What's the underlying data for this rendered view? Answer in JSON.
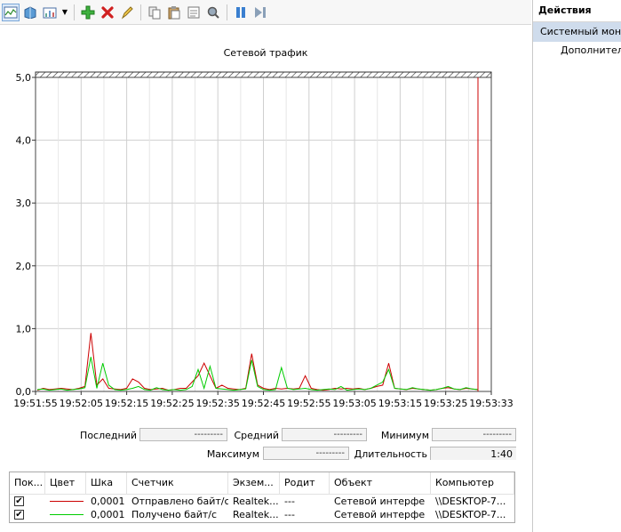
{
  "toolbar": {
    "buttons": [
      {
        "icon": "view-graph-icon",
        "active": true
      },
      {
        "icon": "view-histogram-icon"
      },
      {
        "icon": "change-graph-type-icon"
      },
      {
        "icon": "add-counter-icon"
      },
      {
        "icon": "delete-counter-icon"
      },
      {
        "icon": "highlight-icon"
      },
      {
        "icon": "copy-properties-icon"
      },
      {
        "icon": "paste-counter-list-icon"
      },
      {
        "icon": "properties-icon"
      },
      {
        "icon": "zoom-icon"
      },
      {
        "icon": "freeze-display-icon"
      },
      {
        "icon": "update-data-icon"
      }
    ]
  },
  "actions": {
    "header": "Действия",
    "section": "Системный мони",
    "item": "Дополнител"
  },
  "chart_data": {
    "type": "line",
    "title": "Сетевой трафик",
    "ylim": [
      0,
      5
    ],
    "yticks": [
      "0,0",
      "1,0",
      "2,0",
      "3,0",
      "4,0",
      "5,0"
    ],
    "xticks": [
      "19:51:55",
      "19:52:05",
      "19:52:15",
      "19:52:25",
      "19:52:35",
      "19:52:45",
      "19:52:55",
      "19:53:05",
      "19:53:15",
      "19:53:25",
      "19:53:33"
    ],
    "grid": true,
    "series": [
      {
        "name": "Отправлено байт/с",
        "color": "#cc0000",
        "values": [
          0.02,
          0.05,
          0.03,
          0.04,
          0.05,
          0.04,
          0.03,
          0.05,
          0.08,
          0.93,
          0.1,
          0.2,
          0.05,
          0.04,
          0.03,
          0.05,
          0.2,
          0.15,
          0.05,
          0.03,
          0.04,
          0.05,
          0.02,
          0.03,
          0.05,
          0.05,
          0.15,
          0.25,
          0.45,
          0.25,
          0.05,
          0.1,
          0.05,
          0.04,
          0.03,
          0.05,
          0.6,
          0.1,
          0.05,
          0.03,
          0.05,
          0.04,
          0.05,
          0.04,
          0.05,
          0.25,
          0.05,
          0.03,
          0.02,
          0.03,
          0.05,
          0.04,
          0.05,
          0.04,
          0.05,
          0.03,
          0.05,
          0.08,
          0.1,
          0.45,
          0.05,
          0.04,
          0.03,
          0.05,
          0.04,
          0.03,
          0.02,
          0.03,
          0.05,
          0.06,
          0.04,
          0.03,
          0.05,
          0.04,
          0.03
        ]
      },
      {
        "name": "Получено байт/с",
        "color": "#00cc00",
        "values": [
          0.03,
          0.04,
          0.02,
          0.03,
          0.04,
          0.02,
          0.03,
          0.04,
          0.06,
          0.55,
          0.05,
          0.45,
          0.1,
          0.03,
          0.02,
          0.03,
          0.05,
          0.08,
          0.03,
          0.02,
          0.06,
          0.03,
          0.02,
          0.03,
          0.02,
          0.03,
          0.08,
          0.35,
          0.05,
          0.4,
          0.05,
          0.04,
          0.03,
          0.02,
          0.03,
          0.04,
          0.5,
          0.08,
          0.03,
          0.02,
          0.03,
          0.38,
          0.05,
          0.03,
          0.04,
          0.05,
          0.03,
          0.02,
          0.03,
          0.04,
          0.03,
          0.08,
          0.02,
          0.03,
          0.04,
          0.03,
          0.05,
          0.1,
          0.15,
          0.35,
          0.05,
          0.04,
          0.03,
          0.06,
          0.04,
          0.03,
          0.02,
          0.03,
          0.05,
          0.08,
          0.04,
          0.03,
          0.06,
          0.04,
          0.03
        ]
      }
    ]
  },
  "stats": {
    "last_label": "Последний",
    "last_value": "---------",
    "avg_label": "Средний",
    "avg_value": "---------",
    "min_label": "Минимум",
    "min_value": "---------",
    "max_label": "Максимум",
    "max_value": "---------",
    "duration_label": "Длительность",
    "duration_value": "1:40"
  },
  "counters": {
    "headers": [
      "Пок...",
      "Цвет",
      "Шка",
      "Счетчик",
      "Экзем...",
      "Родит",
      "Объект",
      "Компьютер"
    ],
    "rows": [
      {
        "checked": true,
        "color": "#cc0000",
        "scale": "0,0001",
        "counter": "Отправлено байт/с",
        "instance": "Realtek...",
        "parent": "---",
        "object": "Сетевой интерфе",
        "computer": "\\\\DESKTOP-7..."
      },
      {
        "checked": true,
        "color": "#00cc00",
        "scale": "0,0001",
        "counter": "Получено байт/с",
        "instance": "Realtek...",
        "parent": "---",
        "object": "Сетевой интерфе",
        "computer": "\\\\DESKTOP-7..."
      }
    ]
  }
}
